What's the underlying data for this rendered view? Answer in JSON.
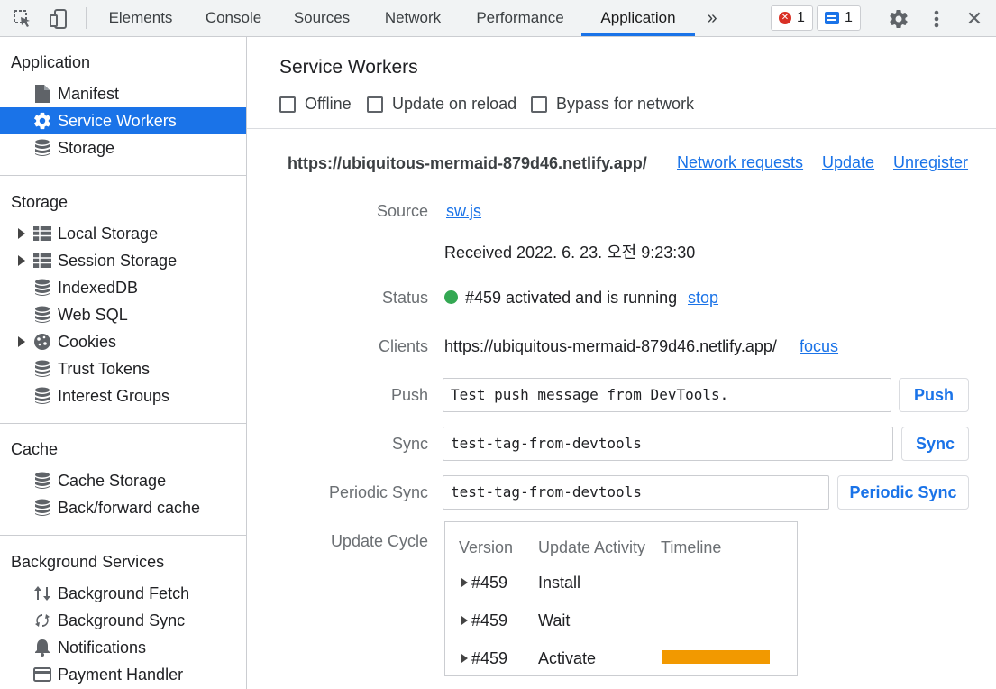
{
  "toolbar": {
    "tabs": [
      "Elements",
      "Console",
      "Sources",
      "Network",
      "Performance",
      "Application"
    ],
    "active_tab": "Application",
    "more": "»",
    "error_count": "1",
    "message_count": "1",
    "close": "✕"
  },
  "sidebar": {
    "sections": [
      {
        "title": "Application",
        "items": [
          {
            "label": "Manifest",
            "icon": "file-icon"
          },
          {
            "label": "Service Workers",
            "icon": "gear-icon",
            "selected": true
          },
          {
            "label": "Storage",
            "icon": "database-icon"
          }
        ]
      },
      {
        "title": "Storage",
        "items": [
          {
            "label": "Local Storage",
            "icon": "table-icon",
            "expandable": true
          },
          {
            "label": "Session Storage",
            "icon": "table-icon",
            "expandable": true
          },
          {
            "label": "IndexedDB",
            "icon": "database-icon"
          },
          {
            "label": "Web SQL",
            "icon": "database-icon"
          },
          {
            "label": "Cookies",
            "icon": "cookie-icon",
            "expandable": true
          },
          {
            "label": "Trust Tokens",
            "icon": "database-icon"
          },
          {
            "label": "Interest Groups",
            "icon": "database-icon"
          }
        ]
      },
      {
        "title": "Cache",
        "items": [
          {
            "label": "Cache Storage",
            "icon": "database-icon"
          },
          {
            "label": "Back/forward cache",
            "icon": "database-icon"
          }
        ]
      },
      {
        "title": "Background Services",
        "items": [
          {
            "label": "Background Fetch",
            "icon": "up-down-arrows-icon"
          },
          {
            "label": "Background Sync",
            "icon": "sync-icon"
          },
          {
            "label": "Notifications",
            "icon": "bell-icon"
          },
          {
            "label": "Payment Handler",
            "icon": "card-icon"
          }
        ]
      }
    ]
  },
  "main": {
    "title": "Service Workers",
    "checkboxes": [
      "Offline",
      "Update on reload",
      "Bypass for network"
    ],
    "origin": "https://ubiquitous-mermaid-879d46.netlify.app/",
    "origin_links": [
      "Network requests",
      "Update",
      "Unregister"
    ],
    "source_label": "Source",
    "source_link": "sw.js",
    "received": "Received 2022. 6. 23. 오전 9:23:30",
    "status_label": "Status",
    "status_text": "#459 activated and is running",
    "status_link": "stop",
    "status_color": "#34a853",
    "clients_label": "Clients",
    "clients_value": "https://ubiquitous-mermaid-879d46.netlify.app/",
    "clients_link": "focus",
    "push_label": "Push",
    "push_value": "Test push message from DevTools.",
    "push_button": "Push",
    "sync_label": "Sync",
    "sync_value": "test-tag-from-devtools",
    "sync_button": "Sync",
    "periodic_label": "Periodic Sync",
    "periodic_value": "test-tag-from-devtools",
    "periodic_button": "Periodic Sync",
    "update_cycle_label": "Update Cycle",
    "update_cycle": {
      "headers": [
        "Version",
        "Update Activity",
        "Timeline"
      ],
      "rows": [
        {
          "version": "#459",
          "activity": "Install",
          "color": "#1e8e8e"
        },
        {
          "version": "#459",
          "activity": "Wait",
          "color": "#9334e6"
        },
        {
          "version": "#459",
          "activity": "Activate",
          "color": "#f29900"
        }
      ]
    }
  }
}
